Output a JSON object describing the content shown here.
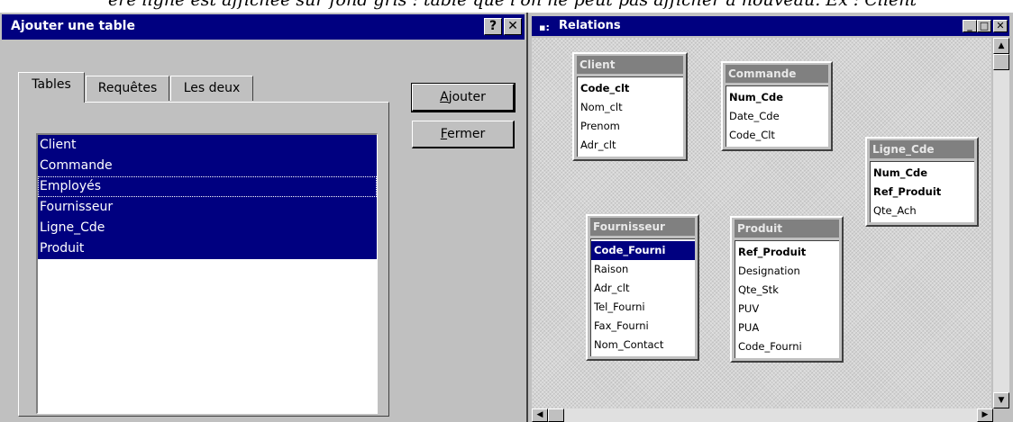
{
  "top_caption": "ère ligne est affichée sur fond gris : table que l'on ne peut pas afficher à nouveau. Ex : Client",
  "dialog": {
    "title": "Ajouter une table",
    "help_label": "?",
    "close_label": "✕",
    "tabs": [
      "Tables",
      "Requêtes",
      "Les deux"
    ],
    "tables": [
      "Client",
      "Commande",
      "Employés",
      "Fournisseur",
      "Ligne_Cde",
      "Produit"
    ],
    "buttons": {
      "add_mnemonic": "A",
      "add_rest": "jouter",
      "close_mnemonic": "F",
      "close_rest": "ermer"
    }
  },
  "relations": {
    "title": "Relations",
    "icon": "relations-icon",
    "tables": [
      {
        "name": "Client",
        "fields": [
          "Code_clt",
          "Nom_clt",
          "Prenom",
          "Adr_clt"
        ],
        "primary": [
          "Code_clt"
        ]
      },
      {
        "name": "Commande",
        "fields": [
          "Num_Cde",
          "Date_Cde",
          "Code_Clt"
        ],
        "primary": [
          "Num_Cde"
        ]
      },
      {
        "name": "Ligne_Cde",
        "fields": [
          "Num_Cde",
          "Ref_Produit",
          "Qte_Ach"
        ],
        "primary": [
          "Num_Cde",
          "Ref_Produit"
        ]
      },
      {
        "name": "Fournisseur",
        "fields": [
          "Code_Fourni",
          "Raison",
          "Adr_clt",
          "Tel_Fourni",
          "Fax_Fourni",
          "Nom_Contact"
        ],
        "primary": [
          "Code_Fourni"
        ],
        "selected": "Code_Fourni"
      },
      {
        "name": "Produit",
        "fields": [
          "Ref_Produit",
          "Designation",
          "Qte_Stk",
          "PUV",
          "PUA",
          "Code_Fourni"
        ],
        "primary": [
          "Ref_Produit"
        ]
      }
    ]
  }
}
